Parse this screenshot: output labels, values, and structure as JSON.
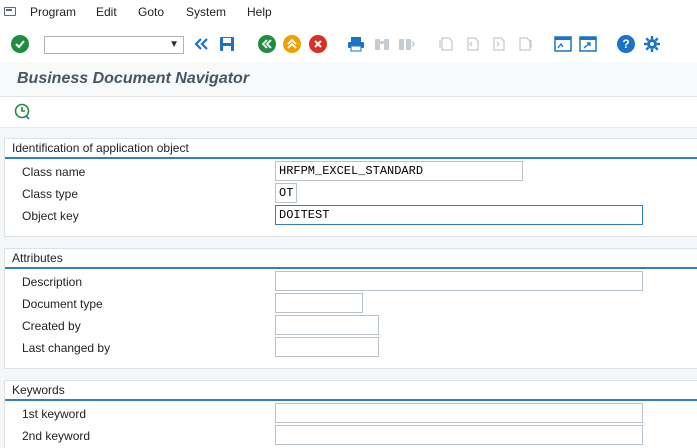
{
  "menu": {
    "items": [
      "Program",
      "Edit",
      "Goto",
      "System",
      "Help"
    ]
  },
  "toolbar": {
    "icons": [
      "enter-icon",
      "back-icon",
      "save-icon",
      "back-nav-icon",
      "exit-icon",
      "cancel-icon",
      "print-icon",
      "find-icon",
      "find-next-icon",
      "first-page-icon",
      "prev-page-icon",
      "next-page-icon",
      "last-page-icon",
      "new-session-icon",
      "shortcut-icon",
      "help-icon",
      "settings-icon"
    ],
    "colors": {
      "green": "#1e8e3e",
      "blue": "#1a73c9",
      "orange": "#f0a000",
      "red": "#d93025",
      "disabled": "#c5cdd3"
    }
  },
  "title": "Business Document Navigator",
  "groups": {
    "identification": {
      "title": "Identification of application object",
      "fields": [
        {
          "label": "Class name",
          "value": "HRFPM_EXCEL_STANDARD"
        },
        {
          "label": "Class type",
          "value": "OT"
        },
        {
          "label": "Object key",
          "value": "DOITEST"
        }
      ]
    },
    "attributes": {
      "title": "Attributes",
      "fields": [
        {
          "label": "Description",
          "value": ""
        },
        {
          "label": "Document type",
          "value": ""
        },
        {
          "label": "Created by",
          "value": ""
        },
        {
          "label": "Last changed by",
          "value": ""
        }
      ]
    },
    "keywords": {
      "title": "Keywords",
      "fields": [
        {
          "label": "1st keyword",
          "value": ""
        },
        {
          "label": "2nd keyword",
          "value": ""
        }
      ]
    }
  }
}
